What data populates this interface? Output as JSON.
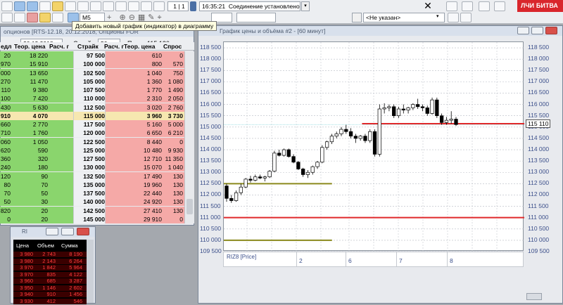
{
  "toolbar": {
    "interval_select": "M5",
    "page_counter": "1 | 1",
    "time": "16:35:21",
    "connection_status": "Соединение установлено",
    "account_select": "<Не указан>",
    "logo_main": "ЛЧИ",
    "logo_sub": "БИТВА"
  },
  "tooltip": "Добавить новый график (индикатор) в диаграмму",
  "colors": {
    "buy": "#8ad56d",
    "sell": "#f5a9a7",
    "center": "#f6e7b0",
    "level_red": "#e0282a",
    "level_olive": "#8b8a1d",
    "accent": "#d9262c"
  },
  "board": {
    "title": "опционов [RTS-12.18, 20.12.2018, Опционы FOR",
    "controls": {
      "date": "20.12.2018",
      "strikes_label": "Страйков:",
      "strikes_value": "50",
      "last_label": "Посл.:",
      "last_value": "115 120"
    },
    "columns": [
      "едл",
      "Теор. цена",
      "Расч. г",
      "Страйк",
      "Расч. г",
      "Теор. цена",
      "Спрос"
    ],
    "rows": [
      [
        "20",
        "18 220",
        "",
        "97 500",
        "",
        "610",
        "0"
      ],
      [
        "970",
        "15 910",
        "",
        "100 000",
        "",
        "800",
        "570"
      ],
      [
        "000",
        "13 650",
        "",
        "102 500",
        "",
        "1 040",
        "750"
      ],
      [
        "270",
        "11 470",
        "",
        "105 000",
        "",
        "1 360",
        "1 080"
      ],
      [
        "110",
        "9 380",
        "",
        "107 500",
        "",
        "1 770",
        "1 490"
      ],
      [
        "100",
        "7 420",
        "",
        "110 000",
        "",
        "2 310",
        "2 050"
      ],
      [
        "430",
        "5 630",
        "",
        "112 500",
        "",
        "3 020",
        "2 760"
      ],
      [
        "910",
        "4 070",
        "",
        "115 000",
        "",
        "3 960",
        "3 730"
      ],
      [
        "660",
        "2 770",
        "",
        "117 500",
        "",
        "5 160",
        "5 000"
      ],
      [
        "710",
        "1 760",
        "",
        "120 000",
        "",
        "6 650",
        "6 210"
      ],
      [
        "060",
        "1 050",
        "",
        "122 500",
        "",
        "8 440",
        "0"
      ],
      [
        "620",
        "590",
        "",
        "125 000",
        "",
        "10 480",
        "9 930"
      ],
      [
        "360",
        "320",
        "",
        "127 500",
        "",
        "12 710",
        "11 350"
      ],
      [
        "240",
        "180",
        "",
        "130 000",
        "",
        "15 070",
        "1 040"
      ],
      [
        "120",
        "90",
        "",
        "132 500",
        "",
        "17 490",
        "130"
      ],
      [
        "80",
        "70",
        "",
        "135 000",
        "",
        "19 960",
        "130"
      ],
      [
        "70",
        "50",
        "",
        "137 500",
        "",
        "22 440",
        "130"
      ],
      [
        "50",
        "30",
        "",
        "140 000",
        "",
        "24 920",
        "130"
      ],
      [
        "820",
        "20",
        "",
        "142 500",
        "",
        "27 410",
        "130"
      ],
      [
        "0",
        "20",
        "",
        "145 000",
        "",
        "29 910",
        "0"
      ]
    ]
  },
  "chart": {
    "title": "График цены и объёма #2 - [60 минут]",
    "series_label": "RIZ8 [Price]",
    "current_price": "115 110",
    "yticks": [
      "118 500",
      "118 000",
      "117 500",
      "117 000",
      "116 500",
      "116 000",
      "115 500",
      "115 000",
      "114 500",
      "114 000",
      "113 500",
      "113 000",
      "112 500",
      "112 000",
      "111 500",
      "111 000",
      "110 500",
      "110 000",
      "109 500"
    ],
    "xticks": [
      "2",
      "6",
      "7",
      "8"
    ]
  },
  "chart_data": {
    "type": "candlestick",
    "ylim": [
      109500,
      118750
    ],
    "right_label": "115 110",
    "levels": [
      {
        "price": 111000,
        "color": "#e0282a",
        "from": 0,
        "to": 1
      },
      {
        "price": 115150,
        "color": "#e0282a",
        "from": 0.46,
        "to": 1
      },
      {
        "price": 112500,
        "color": "#8b8a1d",
        "from": 0,
        "to": 0.36
      },
      {
        "price": 110000,
        "color": "#8b8a1d",
        "from": 0,
        "to": 0.36
      }
    ],
    "candles": [
      [
        112400,
        112500,
        111700,
        111850
      ],
      [
        111850,
        112000,
        111650,
        111750
      ],
      [
        111750,
        112200,
        111700,
        112100
      ],
      [
        112100,
        112500,
        112000,
        112350
      ],
      [
        112350,
        112750,
        112300,
        112700
      ],
      [
        112700,
        112850,
        112550,
        112650
      ],
      [
        112650,
        112900,
        112600,
        112800
      ],
      [
        112800,
        112900,
        112700,
        112750
      ],
      [
        112750,
        112850,
        112600,
        112800
      ],
      [
        112800,
        113100,
        112750,
        113050
      ],
      [
        113050,
        113950,
        113000,
        113850
      ],
      [
        113850,
        114000,
        113700,
        113750
      ],
      [
        113750,
        114050,
        113700,
        114000
      ],
      [
        114000,
        114050,
        113650,
        113700
      ],
      [
        113700,
        113800,
        113400,
        113450
      ],
      [
        113450,
        113500,
        113100,
        113150
      ],
      [
        113150,
        113200,
        112800,
        112900
      ],
      [
        112900,
        113100,
        112750,
        113000
      ],
      [
        113000,
        113300,
        112900,
        113250
      ],
      [
        113250,
        113500,
        113150,
        113450
      ],
      [
        113450,
        114200,
        113400,
        114100
      ],
      [
        114100,
        114400,
        114000,
        114350
      ],
      [
        114350,
        114700,
        114250,
        114600
      ],
      [
        114600,
        114800,
        114500,
        114700
      ],
      [
        114700,
        115000,
        114600,
        114900
      ],
      [
        114900,
        115100,
        114700,
        114800
      ],
      [
        114800,
        114950,
        114500,
        114600
      ],
      [
        114600,
        114700,
        114300,
        114500
      ],
      [
        114500,
        114650,
        114400,
        114600
      ],
      [
        114600,
        114700,
        114300,
        114400
      ],
      [
        114400,
        114900,
        114300,
        114800
      ],
      [
        114800,
        114900,
        113700,
        113800
      ],
      [
        113800,
        116000,
        113700,
        115800
      ],
      [
        115800,
        116050,
        115600,
        115850
      ],
      [
        115850,
        116000,
        115700,
        115900
      ],
      [
        115900,
        116000,
        115400,
        115500
      ],
      [
        115500,
        115900,
        115400,
        115800
      ],
      [
        115800,
        116000,
        115600,
        115750
      ],
      [
        115750,
        115900,
        115600,
        115850
      ],
      [
        115850,
        116050,
        115750,
        116000
      ],
      [
        116000,
        116250,
        115800,
        115900
      ],
      [
        115900,
        116000,
        115700,
        115850
      ],
      [
        115850,
        115950,
        115500,
        115600
      ],
      [
        115600,
        116300,
        115550,
        116200
      ],
      [
        116200,
        116300,
        115400,
        115500
      ],
      [
        115500,
        115600,
        115100,
        115200
      ],
      [
        115200,
        115450,
        115100,
        115300
      ],
      [
        115300,
        115700,
        115150,
        115350
      ],
      [
        115350,
        115450,
        115050,
        115110
      ]
    ]
  },
  "mini": {
    "title": "RI",
    "columns": [
      "Цена",
      "Объем",
      "Сумма"
    ],
    "rows": [
      [
        "3 980",
        "2 743",
        "8 190"
      ],
      [
        "3 980",
        "2 143",
        "6 264"
      ],
      [
        "3 970",
        "1 842",
        "5 964"
      ],
      [
        "3 970",
        "835",
        "4 122"
      ],
      [
        "3 960",
        "685",
        "3 287"
      ],
      [
        "3 950",
        "1 146",
        "2 602"
      ],
      [
        "3 940",
        "910",
        "1 456"
      ],
      [
        "3 930",
        "412",
        "546"
      ]
    ]
  }
}
